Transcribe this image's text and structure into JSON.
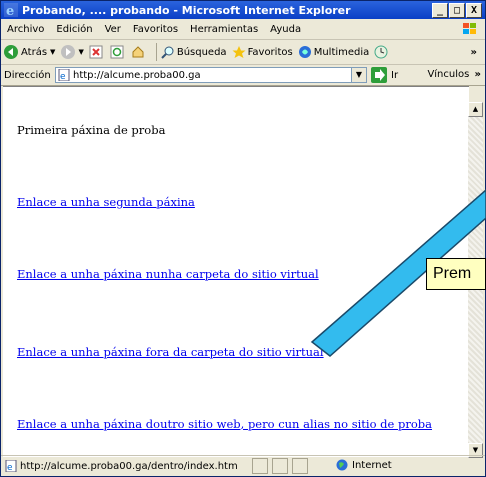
{
  "window": {
    "title": "Probando, .... probando - Microsoft Internet Explorer",
    "buttons": [
      "_",
      "□",
      "X"
    ]
  },
  "menu": [
    "Archivo",
    "Edición",
    "Ver",
    "Favoritos",
    "Herramientas",
    "Ayuda"
  ],
  "toolbar": {
    "back": "Atrás",
    "search": "Búsqueda",
    "favorites": "Favoritos",
    "multimedia": "Multimedia",
    "more": "»"
  },
  "address": {
    "label": "Dirección",
    "url": "http://alcume.proba00.ga",
    "go": "Ir",
    "links": "Vínculos",
    "links_more": "»"
  },
  "content": {
    "heading": "Primeira páxina de proba",
    "links": [
      "Enlace a unha segunda páxina",
      "Enlace a unha páxina nunha carpeta do sitio virtual",
      "Enlace a unha páxina fora da carpeta do sitio virtual",
      "Enlace a unha páxina doutro sitio web, pero cun alias no sitio de proba"
    ]
  },
  "status": {
    "url": "http://alcume.proba00.ga/dentro/index.htm",
    "zone": "Internet"
  },
  "callout": {
    "text": "Prem",
    "color": "#ffffc0",
    "arrow_color": "#33bbee"
  }
}
